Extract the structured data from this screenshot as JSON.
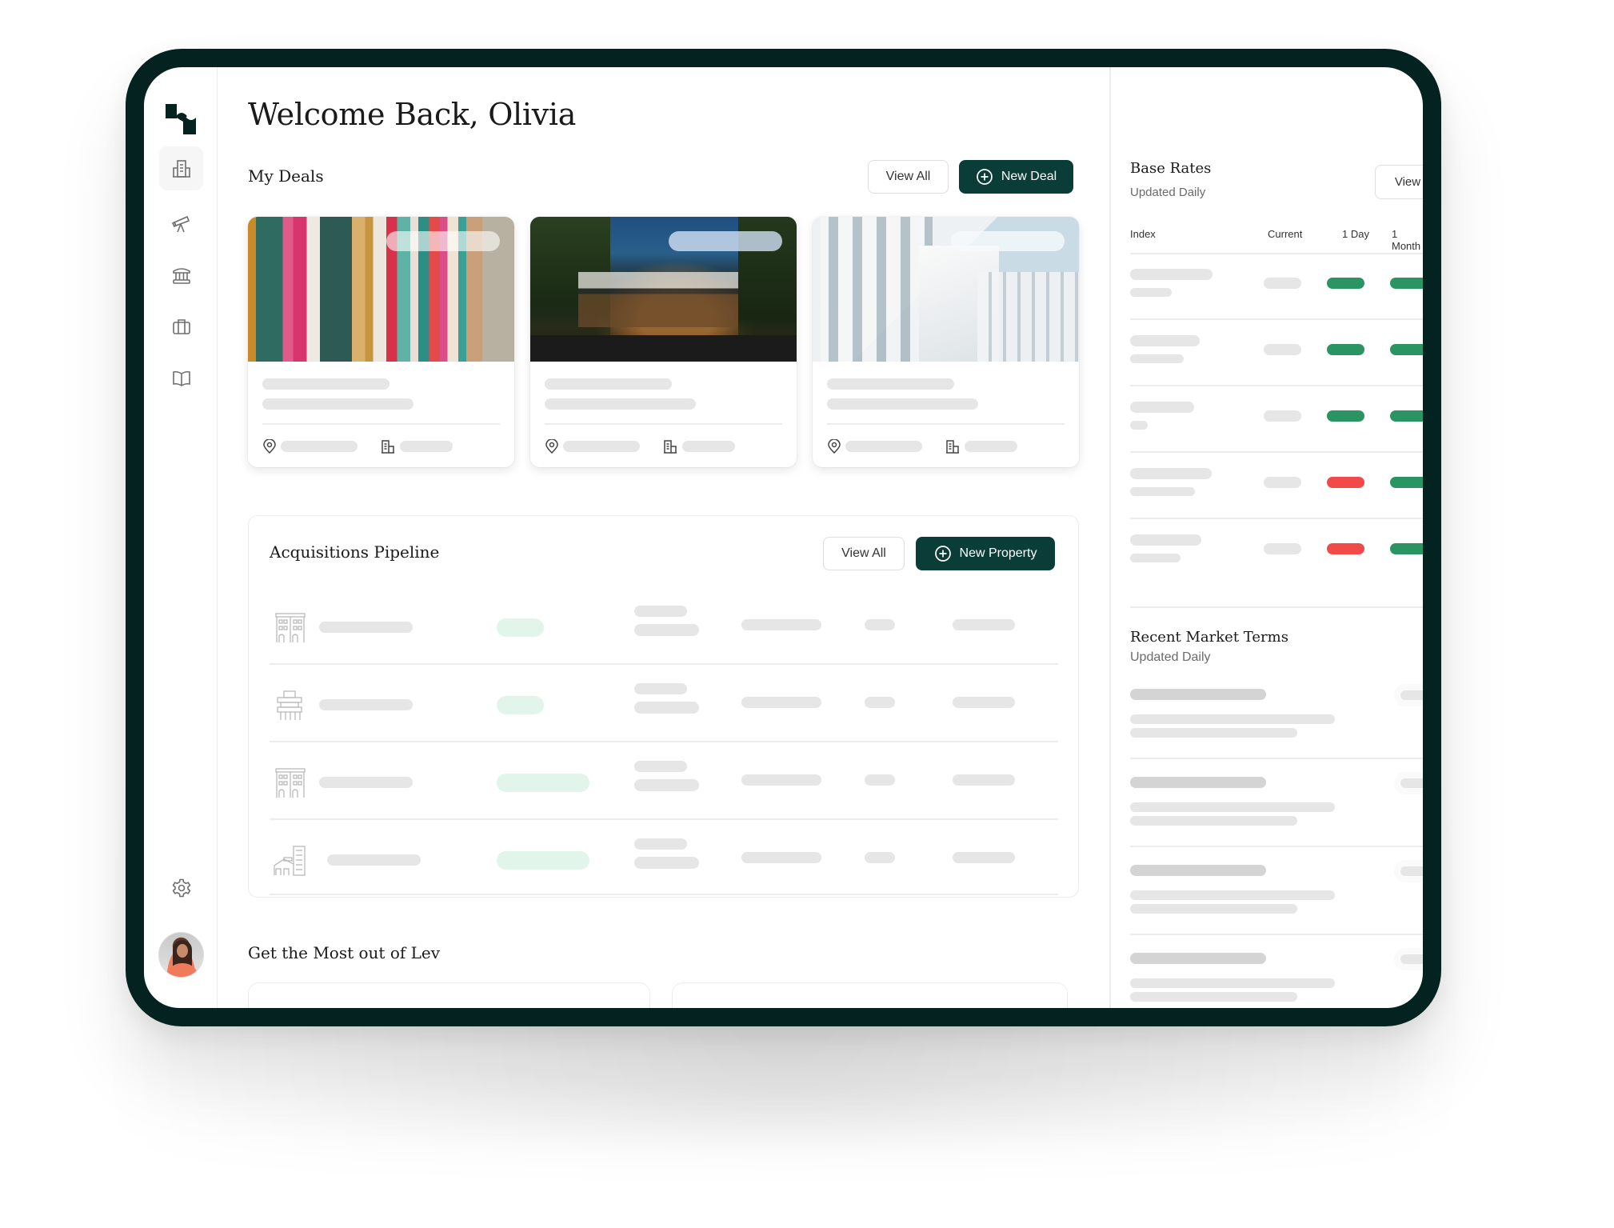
{
  "app": {
    "name": "Lev"
  },
  "header": {
    "title": "Welcome Back, Olivia"
  },
  "sidebar": {
    "items": [
      {
        "name": "properties",
        "icon": "building-icon",
        "active": true
      },
      {
        "name": "explore",
        "icon": "telescope-icon",
        "active": false
      },
      {
        "name": "lenders",
        "icon": "bank-icon",
        "active": false
      },
      {
        "name": "portfolio",
        "icon": "briefcase-icon",
        "active": false
      },
      {
        "name": "resources",
        "icon": "book-icon",
        "active": false
      }
    ],
    "settings_icon": "gear-icon",
    "user": {
      "name": "Olivia",
      "avatar": "avatar"
    }
  },
  "my_deals": {
    "title": "My Deals",
    "view_all_label": "View All",
    "new_deal_label": "New Deal",
    "cards": [
      {
        "image": "colorful-columns-building",
        "location_icon": "map-pin-icon",
        "type_icon": "building-icon"
      },
      {
        "image": "night-restaurant-exterior",
        "location_icon": "map-pin-icon",
        "type_icon": "building-icon"
      },
      {
        "image": "white-modern-apartment",
        "location_icon": "map-pin-icon",
        "type_icon": "building-icon"
      }
    ]
  },
  "pipeline": {
    "title": "Acquisitions Pipeline",
    "view_all_label": "View All",
    "new_property_label": "New Property",
    "rows": [
      {
        "icon": "apartment-building-icon"
      },
      {
        "icon": "modern-tower-icon"
      },
      {
        "icon": "apartment-building-icon"
      },
      {
        "icon": "mixed-use-building-icon"
      }
    ]
  },
  "tips": {
    "title": "Get the Most out of Lev",
    "cards": [
      {
        "close_icon": "close-icon"
      },
      {
        "close_icon": "close-icon"
      }
    ]
  },
  "base_rates": {
    "title": "Base Rates",
    "subtitle": "Updated Daily",
    "view_all_label": "View All",
    "columns": [
      "Index",
      "Current",
      "1 Day",
      "1 Month"
    ],
    "rows": [
      {
        "day_trend": "up",
        "month_trend": "up"
      },
      {
        "day_trend": "up",
        "month_trend": "up"
      },
      {
        "day_trend": "up",
        "month_trend": "up"
      },
      {
        "day_trend": "down",
        "month_trend": "up"
      },
      {
        "day_trend": "down",
        "month_trend": "up"
      }
    ],
    "colors": {
      "up": "#2a9463",
      "down": "#f24a4a"
    }
  },
  "market_terms": {
    "title": "Recent Market Terms",
    "subtitle": "Updated Daily",
    "row_count": 4
  },
  "colors": {
    "primary": "#0b3d38",
    "frame": "#042220"
  }
}
